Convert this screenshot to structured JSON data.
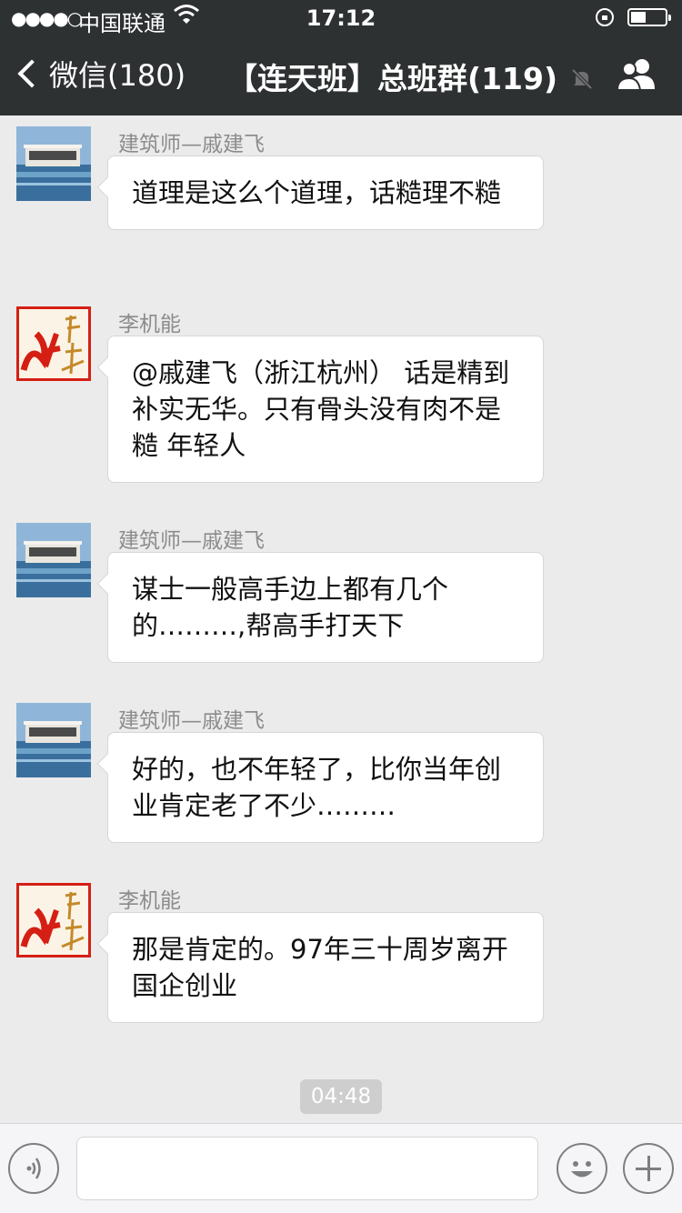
{
  "status_bar": {
    "signal": "●●●●○",
    "carrier": "中国联通",
    "wifi_icon": "wifi-icon",
    "time": "17:12",
    "battery_level": 0.45
  },
  "nav": {
    "back_label": "微信(180)",
    "title": "【连天班】总班群(119)",
    "mute_icon": "mute-bell-icon",
    "group_icon": "group-members-icon"
  },
  "messages": [
    {
      "sender": "建筑师—戚建飞",
      "avatar": "building-photo",
      "text": "道理是这么个道理，话糙理不糙"
    },
    {
      "sender": "李机能",
      "avatar": "red-calligraphy",
      "text": "@戚建飞（浙江杭州） 话是精到补实无华。只有骨头没有肉不是糙 年轻人"
    },
    {
      "sender": "建筑师—戚建飞",
      "avatar": "building-photo",
      "text": "谋士一般高手边上都有几个的………,帮高手打天下"
    },
    {
      "sender": "建筑师—戚建飞",
      "avatar": "building-photo",
      "text": "好的，也不年轻了，比你当年创业肯定老了不少………"
    },
    {
      "sender": "李机能",
      "avatar": "red-calligraphy",
      "text": "那是肯定的。97年三十周岁离开国企创业"
    }
  ],
  "timestamp": "04:48",
  "input_bar": {
    "voice_icon": "voice-icon",
    "input_value": "",
    "emoji_icon": "emoji-icon",
    "plus_icon": "plus-icon"
  },
  "colors": {
    "nav_bg": "#2e3132",
    "chat_bg": "#ebebeb",
    "bubble_bg": "#ffffff",
    "avatar_red": "#d51f14"
  }
}
